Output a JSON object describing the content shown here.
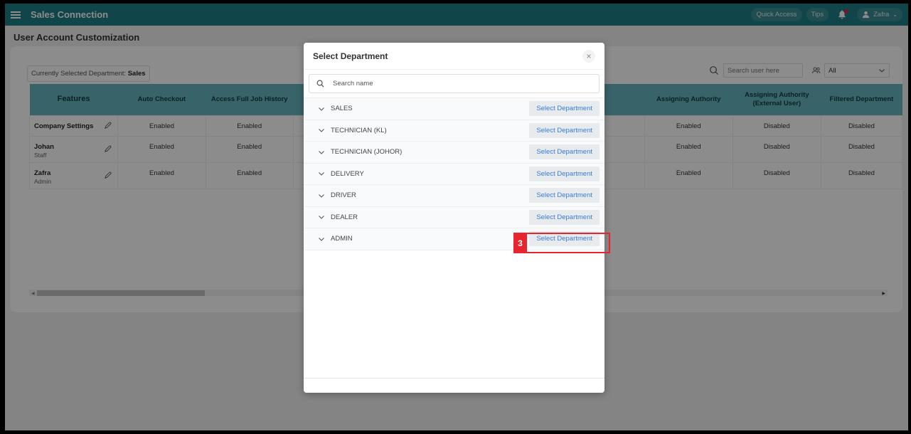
{
  "topbar": {
    "app_title": "Sales Connection",
    "quick_access": "Quick Access",
    "tips": "Tips",
    "user_name": "Zafra"
  },
  "page": {
    "title": "User Account Customization",
    "current_dept_label": "Currently Selected Department:",
    "current_dept_value": "Sales",
    "user_search_placeholder": "Search user here",
    "filter_value": "All"
  },
  "table": {
    "headers": [
      "Features",
      "Auto Checkout",
      "Access Full Job History",
      "Assigning Authority",
      "Assigning Authority (External User)",
      "Filtered Department"
    ],
    "rows": [
      {
        "name": "Company Settings",
        "role": "",
        "values": [
          "Enabled",
          "Enabled",
          "Enabled",
          "Disabled",
          "Disabled"
        ]
      },
      {
        "name": "Johan",
        "role": "Staff",
        "values": [
          "Enabled",
          "Enabled",
          "Enabled",
          "Disabled",
          "Disabled"
        ]
      },
      {
        "name": "Zafra",
        "role": "Admin",
        "values": [
          "Enabled",
          "Enabled",
          "Enabled",
          "Disabled",
          "Disabled"
        ]
      }
    ]
  },
  "modal": {
    "title": "Select Department",
    "search_placeholder": "Search name",
    "button_label": "Select Department",
    "departments": [
      "SALES",
      "TECHNICIAN (KL)",
      "TECHNICIAN (JOHOR)",
      "DELIVERY",
      "DRIVER",
      "DEALER",
      "ADMIN"
    ]
  },
  "annotation": {
    "step_number": "3"
  },
  "colors": {
    "brand": "#1e7e86",
    "enabled": "#258a80",
    "disabled": "#d81c45",
    "highlight": "#e8252e"
  }
}
